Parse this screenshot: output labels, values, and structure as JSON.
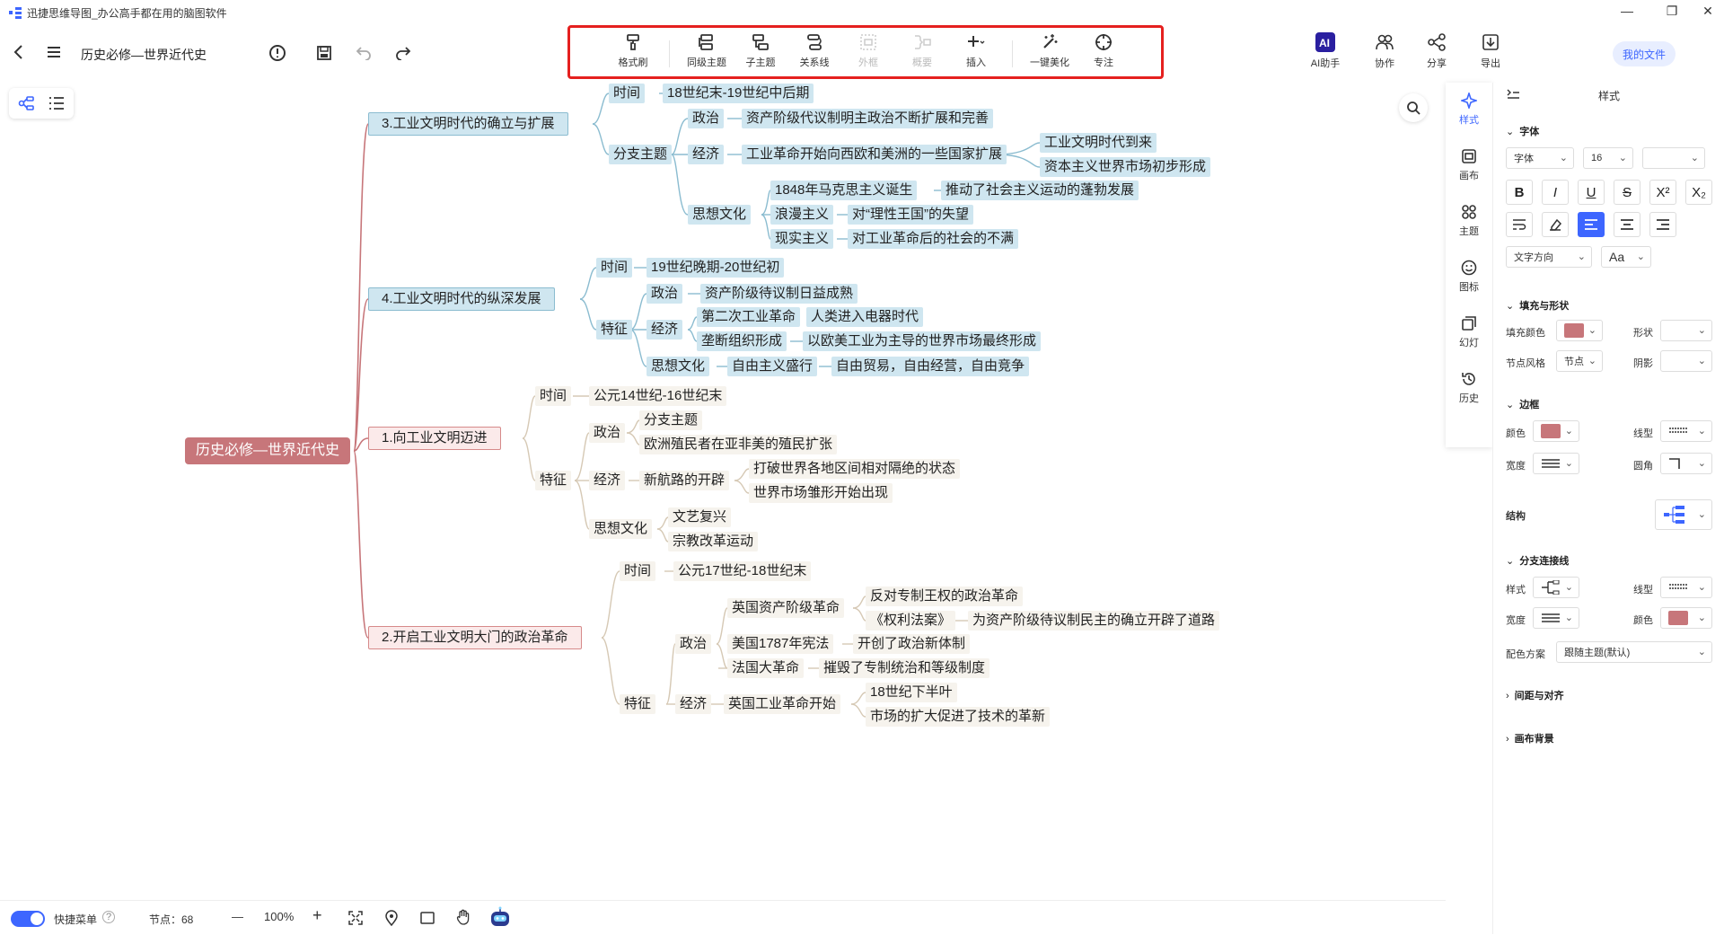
{
  "window": {
    "title": "迅捷思维导图_办公高手都在用的脑图软件",
    "min": "—",
    "max": "❐",
    "close": "✕"
  },
  "toolbar": {
    "doc_title": "历史必修—世界近代史",
    "tools": [
      {
        "label": "格式刷",
        "icon": "format-brush-icon",
        "enabled": true
      },
      {
        "label": "同级主题",
        "icon": "sibling-topic-icon",
        "enabled": true
      },
      {
        "label": "子主题",
        "icon": "child-topic-icon",
        "enabled": true
      },
      {
        "label": "关系线",
        "icon": "relation-line-icon",
        "enabled": true
      },
      {
        "label": "外框",
        "icon": "boundary-icon",
        "enabled": false
      },
      {
        "label": "概要",
        "icon": "summary-icon",
        "enabled": false
      },
      {
        "label": "插入",
        "icon": "insert-icon",
        "enabled": true
      },
      {
        "label": "一键美化",
        "icon": "magic-wand-icon",
        "enabled": true
      },
      {
        "label": "专注",
        "icon": "focus-icon",
        "enabled": true
      }
    ],
    "right_tools": [
      {
        "label": "AI助手",
        "icon": "ai-assistant-icon"
      },
      {
        "label": "协作",
        "icon": "collaborate-icon"
      },
      {
        "label": "分享",
        "icon": "share-icon"
      },
      {
        "label": "导出",
        "icon": "export-icon"
      }
    ],
    "my_files": "我的文件",
    "ai_badge": "AI"
  },
  "mindmap": {
    "root": "历史必修—世界近代史",
    "nodes": {
      "b3": "3.工业文明时代的确立与扩展",
      "b3_time": "时间",
      "b3_time_v": "18世纪末-19世纪中后期",
      "b3_branch": "分支主题",
      "b3_pol": "政治",
      "b3_pol_v": "资产阶级代议制明主政治不断扩展和完善",
      "b3_eco": "经济",
      "b3_eco_v": "工业革命开始向西欧和美洲的一些国家扩展",
      "b3_eco_v1": "工业文明时代到来",
      "b3_eco_v2": "资本主义世界市场初步形成",
      "b3_cul": "思想文化",
      "b3_cul_1": "1848年马克思主义诞生",
      "b3_cul_1v": "推动了社会主义运动的蓬勃发展",
      "b3_cul_2": "浪漫主义",
      "b3_cul_2v": "对“理性王国”的失望",
      "b3_cul_3": "现实主义",
      "b3_cul_3v": "对工业革命后的社会的不满",
      "b4": "4.工业文明时代的纵深发展",
      "b4_time": "时间",
      "b4_time_v": "19世纪晚期-20世纪初",
      "b4_feat": "特征",
      "b4_pol": "政治",
      "b4_pol_v": "资产阶级待议制日益成熟",
      "b4_eco": "经济",
      "b4_eco_1": "第二次工业革命",
      "b4_eco_1v": "人类进入电器时代",
      "b4_eco_2": "垄断组织形成",
      "b4_eco_2v": "以欧美工业为主导的世界市场最终形成",
      "b4_cul": "思想文化",
      "b4_cul_v": "自由主义盛行",
      "b4_cul_vv": "自由贸易，自由经营，自由竞争",
      "b1": "1.向工业文明迈进",
      "b1_time": "时间",
      "b1_time_v": "公元14世纪-16世纪末",
      "b1_feat": "特征",
      "b1_pol": "政治",
      "b1_pol_1": "分支主题",
      "b1_pol_2": "欧洲殖民者在亚非美的殖民扩张",
      "b1_eco": "经济",
      "b1_eco_v": "新航路的开辟",
      "b1_eco_v1": "打破世界各地区间相对隔绝的状态",
      "b1_eco_v2": "世界市场雏形开始出现",
      "b1_cul": "思想文化",
      "b1_cul_1": "文艺复兴",
      "b1_cul_2": "宗教改革运动",
      "b2": "2.开启工业文明大门的政治革命",
      "b2_time": "时间",
      "b2_time_v": "公元17世纪-18世纪末",
      "b2_feat": "特征",
      "b2_pol": "政治",
      "b2_pol_1": "英国资产阶级革命",
      "b2_pol_1a": "反对专制王权的政治革命",
      "b2_pol_1b": "《权利法案》",
      "b2_pol_1bv": "为资产阶级待议制民主的确立开辟了道路",
      "b2_pol_2": "美国1787年宪法",
      "b2_pol_2v": "开创了政治新体制",
      "b2_pol_3": "法国大革命",
      "b2_pol_3v": "摧毁了专制统治和等级制度",
      "b2_eco": "经济",
      "b2_eco_v": "英国工业革命开始",
      "b2_eco_v1": "18世纪下半叶",
      "b2_eco_v2": "市场的扩大促进了技术的革新"
    }
  },
  "side_tabs": [
    {
      "label": "样式",
      "icon": "style-icon",
      "active": true
    },
    {
      "label": "画布",
      "icon": "canvas-icon",
      "active": false
    },
    {
      "label": "主题",
      "icon": "theme-icon",
      "active": false
    },
    {
      "label": "图标",
      "icon": "emoji-icon",
      "active": false
    },
    {
      "label": "幻灯",
      "icon": "slides-icon",
      "active": false
    },
    {
      "label": "历史",
      "icon": "history-icon",
      "active": false
    }
  ],
  "panel": {
    "title": "样式",
    "font_section": "字体",
    "font_family": "字体",
    "font_size": "16",
    "text_direction": "文字方向",
    "case_btn": "Aa",
    "fill_section": "填充与形状",
    "fill_color_label": "填充颜色",
    "shape_label": "形状",
    "node_style_label": "节点风格",
    "node_style_value": "节点",
    "shadow_label": "阴影",
    "border_section": "边框",
    "border_color_label": "颜色",
    "border_line_label": "线型",
    "border_width_label": "宽度",
    "border_radius_label": "圆角",
    "structure_label": "结构",
    "branch_section": "分支连接线",
    "branch_style_label": "样式",
    "branch_line_label": "线型",
    "branch_width_label": "宽度",
    "branch_color_label": "颜色",
    "color_scheme_label": "配色方案",
    "color_scheme_value": "跟随主题(默认)",
    "spacing_section": "间距与对齐",
    "bg_section": "画布背景",
    "accent": "#3d66ff",
    "node_color": "#c7767a"
  },
  "bottom": {
    "quick_menu": "快捷菜单",
    "help": "?",
    "node_count": "节点：68",
    "zoom_out": "—",
    "zoom": "100%",
    "zoom_in": "+"
  }
}
